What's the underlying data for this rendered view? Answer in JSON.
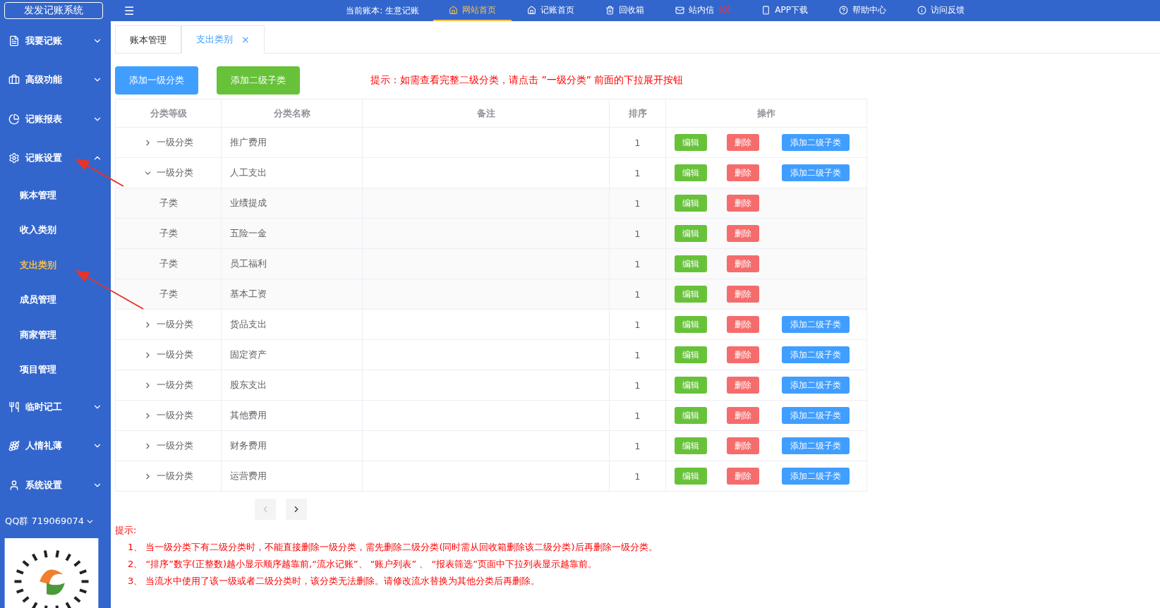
{
  "header": {
    "logo": "发发记账系统",
    "menu_icon": "☰",
    "current_book": "当前账本: 生意记账",
    "nav": [
      {
        "label": "网站首页",
        "selected": true
      },
      {
        "label": "记账首页",
        "selected": false
      },
      {
        "label": "回收箱",
        "selected": false
      },
      {
        "label": "站内信",
        "selected": false,
        "badge": "(0)"
      },
      {
        "label": "APP下载",
        "selected": false
      },
      {
        "label": "帮助中心",
        "selected": false
      },
      {
        "label": "访问反馈",
        "selected": false
      }
    ]
  },
  "sidebar": {
    "items": [
      {
        "label": "我要记账",
        "expanded": false
      },
      {
        "label": "高级功能",
        "expanded": false
      },
      {
        "label": "记账报表",
        "expanded": false
      },
      {
        "label": "记账设置",
        "expanded": true,
        "children": [
          {
            "label": "账本管理",
            "selected": false
          },
          {
            "label": "收入类别",
            "selected": false
          },
          {
            "label": "支出类别",
            "selected": true
          },
          {
            "label": "成员管理",
            "selected": false
          },
          {
            "label": "商家管理",
            "selected": false
          },
          {
            "label": "项目管理",
            "selected": false
          }
        ]
      },
      {
        "label": "临时记工",
        "expanded": false
      },
      {
        "label": "人情礼薄",
        "expanded": false
      },
      {
        "label": "系统设置",
        "expanded": false
      }
    ],
    "qq_group": "QQ群 719069074"
  },
  "tabs": [
    {
      "label": "账本管理",
      "selected": false
    },
    {
      "label": "支出类别",
      "selected": true,
      "close": "×"
    }
  ],
  "buttons": [
    {
      "label": "添加一级分类",
      "kind": "primary"
    },
    {
      "label": "添加二级子类",
      "kind": "success"
    }
  ],
  "hint": "提示：如需查看完整二级分类，请点击 ”一级分类” 前面的下拉展开按钮",
  "table": {
    "columns": [
      "分类等级",
      "分类名称",
      "备注",
      "排序",
      "操作"
    ],
    "rows": [
      {
        "kind": "parent",
        "level": "一级分类",
        "name": "推广费用",
        "sort": "1",
        "expanded": false,
        "edit": "编辑",
        "delete": "删除",
        "add_child": "添加二级子类"
      },
      {
        "kind": "parent",
        "level": "一级分类",
        "name": "人工支出",
        "sort": "1",
        "expanded": true,
        "edit": "编辑",
        "delete": "删除",
        "add_child": "添加二级子类"
      },
      {
        "kind": "child",
        "level": "子类",
        "name": "业绩提成",
        "sort": "1",
        "edit": "编辑",
        "delete": "删除"
      },
      {
        "kind": "child",
        "level": "子类",
        "name": "五险一金",
        "sort": "1",
        "edit": "编辑",
        "delete": "删除"
      },
      {
        "kind": "child",
        "level": "子类",
        "name": "员工福利",
        "sort": "1",
        "edit": "编辑",
        "delete": "删除"
      },
      {
        "kind": "child",
        "level": "子类",
        "name": "基本工资",
        "sort": "1",
        "edit": "编辑",
        "delete": "删除"
      },
      {
        "kind": "parent",
        "level": "一级分类",
        "name": "货品支出",
        "sort": "1",
        "expanded": false,
        "edit": "编辑",
        "delete": "删除",
        "add_child": "添加二级子类"
      },
      {
        "kind": "parent",
        "level": "一级分类",
        "name": "固定资产",
        "sort": "1",
        "expanded": false,
        "edit": "编辑",
        "delete": "删除",
        "add_child": "添加二级子类"
      },
      {
        "kind": "parent",
        "level": "一级分类",
        "name": "股东支出",
        "sort": "1",
        "expanded": false,
        "edit": "编辑",
        "delete": "删除",
        "add_child": "添加二级子类"
      },
      {
        "kind": "parent",
        "level": "一级分类",
        "name": "其他费用",
        "sort": "1",
        "expanded": false,
        "edit": "编辑",
        "delete": "删除",
        "add_child": "添加二级子类"
      },
      {
        "kind": "parent",
        "level": "一级分类",
        "name": "财务费用",
        "sort": "1",
        "expanded": false,
        "edit": "编辑",
        "delete": "删除",
        "add_child": "添加二级子类"
      },
      {
        "kind": "parent",
        "level": "一级分类",
        "name": "运营费用",
        "sort": "1",
        "expanded": false,
        "edit": "编辑",
        "delete": "删除",
        "add_child": "添加二级子类"
      }
    ]
  },
  "pagination": {
    "prev_disabled": true,
    "next_disabled": false
  },
  "notes": {
    "title": "提示:",
    "items": [
      "1、 当一级分类下有二级分类时，不能直接删除一级分类，需先删除二级分类(同时需从回收箱删除该二级分类)后再删除一级分类。",
      "2、 “排序”数字(正整数)越小显示顺序越靠前,“流水记账”、 “账户列表” 、 “报表筛选”页面中下拉列表显示越靠前。",
      "3、 当流水中使用了该一级或者二级分类时，该分类无法删除。请修改流水替换为其他分类后再删除。"
    ]
  }
}
